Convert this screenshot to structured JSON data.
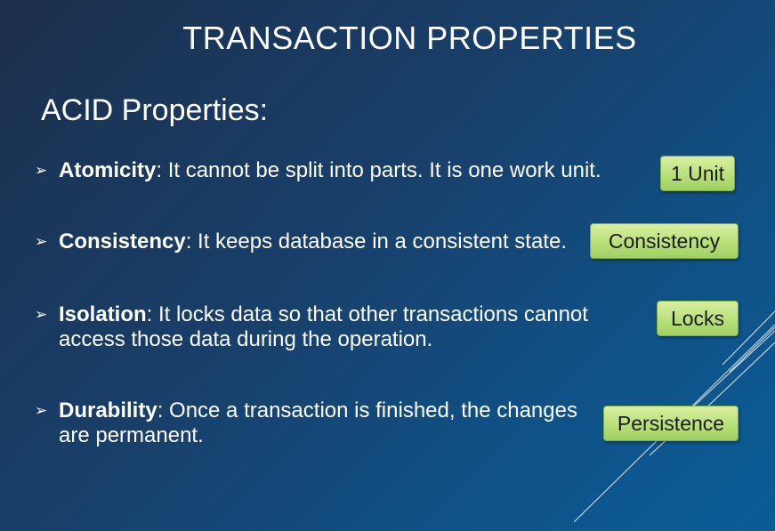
{
  "slide": {
    "title": "TRANSACTION PROPERTIES",
    "subtitle": "ACID Properties:",
    "bullets": [
      {
        "marker": "➢",
        "term": "Atomicity",
        "description": ": It cannot be split into parts. It is one work unit."
      },
      {
        "marker": "➢",
        "term": "Consistency",
        "description": ": It keeps database in a consistent state."
      },
      {
        "marker": "➢",
        "term": "Isolation",
        "description": ": It locks data so that other transactions cannot access those data during the operation."
      },
      {
        "marker": "➢",
        "term": "Durability",
        "description": ": Once a transaction is finished, the changes are permanent."
      }
    ],
    "tags": [
      "1 Unit",
      "Consistency",
      "Locks",
      "Persistence"
    ]
  },
  "colors": {
    "background_dark": "#1c2f4c",
    "background_light": "#0a5c96",
    "text": "#ffffff",
    "tag_fill": "#b6df76",
    "tag_text": "#1b1b1b"
  }
}
